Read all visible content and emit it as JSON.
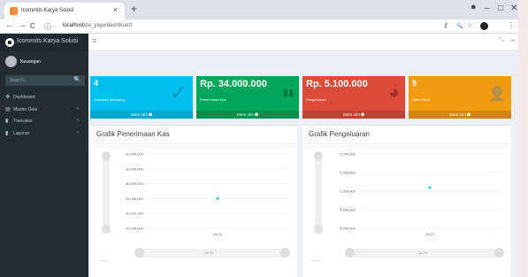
{
  "browser": {
    "tab_title": "Icommits Karya Solusi",
    "tab_close": "×",
    "new_tab": "+",
    "url_host": "localhost",
    "url_path": "/pa_yayu/dashboard",
    "controls": {
      "minimize": "–",
      "maximize": "□",
      "close": "✕"
    },
    "nav": {
      "back": "←",
      "forward": "→",
      "reload": "C",
      "info": "ⓘ"
    },
    "toolbar_icons": {
      "key": "⚷",
      "zoom": "🔍",
      "star": "☆",
      "menu": "⋮"
    }
  },
  "sidebar": {
    "brand": "Icommits Karya Solusi",
    "user": "Keuangan",
    "search_placeholder": "Search...",
    "search_icon": "🔍",
    "items": [
      {
        "label": "Dashboard",
        "icon": "dashboard-icon",
        "glyph": "❖",
        "chevron": ""
      },
      {
        "label": "Master Data",
        "icon": "database-icon",
        "glyph": "▤",
        "chevron": "‹"
      },
      {
        "label": "Transaksi",
        "icon": "file-icon",
        "glyph": "▮",
        "chevron": "‹"
      },
      {
        "label": "Laporan",
        "icon": "file-icon",
        "glyph": "▮",
        "chevron": "‹"
      }
    ]
  },
  "topbar": {
    "menu": "≡",
    "expand": "⤡",
    "share": "⇥"
  },
  "boxes": [
    {
      "value": "4",
      "caption": "Transaksi sekarang",
      "footer": "More info ➊",
      "color": "#00c0ef",
      "icon": "check-icon",
      "glyph": "✓"
    },
    {
      "value": "Rp. 34.000.000",
      "caption": "Penerimaan Kas",
      "footer": "More info ➊",
      "color": "#00a65a",
      "icon": "bar-chart-icon",
      "glyph": "▮▮"
    },
    {
      "value": "Rp. 5.100.000",
      "caption": "Pengeluaran",
      "footer": "More info ➊",
      "color": "#dd4b39",
      "icon": "pie-chart-icon",
      "glyph": "◕"
    },
    {
      "value": "9",
      "caption": "Total Client",
      "footer": "More info ➊",
      "color": "#f39c12",
      "icon": "user-add-icon",
      "glyph": "👤"
    }
  ],
  "charts": [
    {
      "title": "Grafik Penerimaan Kas",
      "ticks": [
        "40,000,000",
        "38,000,000",
        "36,000,000",
        "34,000,000",
        "32,000,000",
        "30,000,000"
      ],
      "xlabel": "Jul 21",
      "nav_label": "Jul 21"
    },
    {
      "title": "Grafik Pengeluaran",
      "ticks": [
        "6,000,000",
        "5,500,000",
        "5,000,000",
        "4,500,000",
        "4,000,000"
      ],
      "xlabel": "Jul 21",
      "nav_label": "Jul 21"
    }
  ],
  "chart_data": [
    {
      "type": "scatter",
      "title": "Grafik Penerimaan Kas",
      "x": [
        "Jul 21"
      ],
      "values": [
        34000000
      ],
      "ylim": [
        30000000,
        40000000
      ],
      "yticks": [
        "40,000,000",
        "38,000,000",
        "36,000,000",
        "34,000,000",
        "32,000,000",
        "30,000,000"
      ],
      "color": "#39cccc"
    },
    {
      "type": "scatter",
      "title": "Grafik Pengeluaran",
      "x": [
        "Jul 21"
      ],
      "values": [
        5100000
      ],
      "ylim": [
        4000000,
        6000000
      ],
      "yticks": [
        "6,000,000",
        "5,500,000",
        "5,000,000",
        "4,500,000",
        "4,000,000"
      ],
      "color": "#39cccc"
    }
  ]
}
